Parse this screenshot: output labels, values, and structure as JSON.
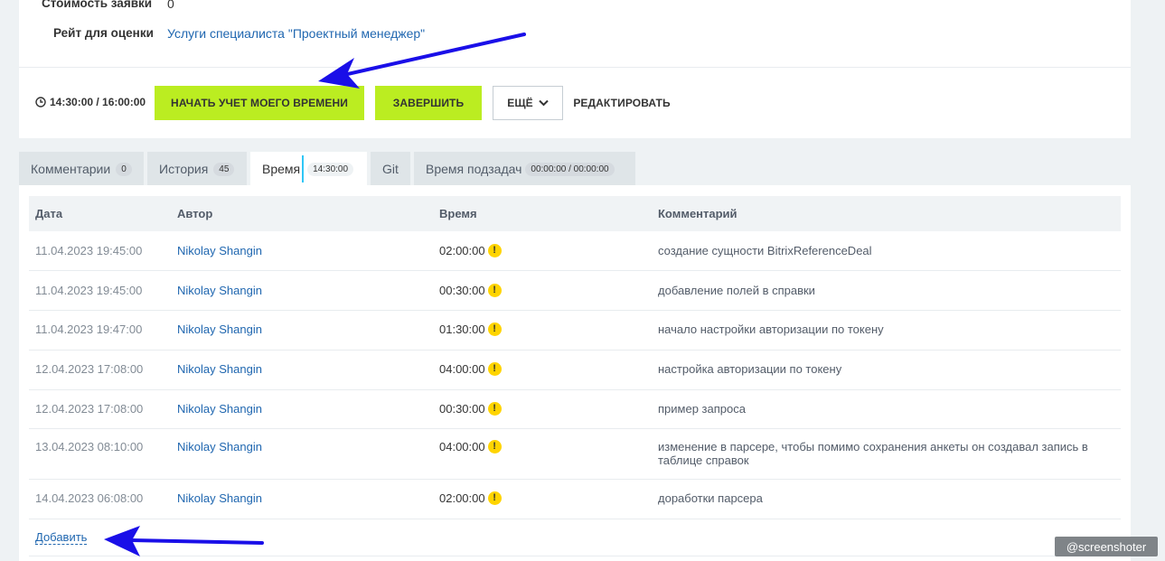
{
  "properties": {
    "cost_label": "Стоимость заявки",
    "cost_value": "0",
    "rate_label": "Рейт для оценки",
    "rate_value": "Услуги специалиста \"Проектный менеджер\""
  },
  "toolbar": {
    "timer_text": "14:30:00 / 16:00:00",
    "start_label": "НАЧАТЬ УЧЕТ МОЕГО ВРЕМЕНИ",
    "finish_label": "ЗАВЕРШИТЬ",
    "more_label": "ЕЩЁ",
    "edit_label": "РЕДАКТИРОВАТЬ"
  },
  "tabs": [
    {
      "label": "Комментарии",
      "badge": "0"
    },
    {
      "label": "История",
      "badge": "45"
    },
    {
      "label": "Время",
      "badge": "14:30:00"
    },
    {
      "label": "Git",
      "badge": ""
    },
    {
      "label": "Время подзадач",
      "badge": "00:00:00 / 00:00:00"
    }
  ],
  "table": {
    "headers": [
      "Дата",
      "Автор",
      "Время",
      "Комментарий"
    ],
    "rows": [
      {
        "date": "11.04.2023 19:45:00",
        "author": "Nikolay Shangin",
        "time": "02:00:00",
        "comment": "создание сущности BitrixReferenceDeal"
      },
      {
        "date": "11.04.2023 19:45:00",
        "author": "Nikolay Shangin",
        "time": "00:30:00",
        "comment": "добавление полей в справки"
      },
      {
        "date": "11.04.2023 19:47:00",
        "author": "Nikolay Shangin",
        "time": "01:30:00",
        "comment": "начало настройки авторизации по токену"
      },
      {
        "date": "12.04.2023 17:08:00",
        "author": "Nikolay Shangin",
        "time": "04:00:00",
        "comment": "настройка авторизации по токену"
      },
      {
        "date": "12.04.2023 17:08:00",
        "author": "Nikolay Shangin",
        "time": "00:30:00",
        "comment": "пример запроса"
      },
      {
        "date": "13.04.2023 08:10:00",
        "author": "Nikolay Shangin",
        "time": "04:00:00",
        "comment": "изменение в парсере, чтобы помимо сохранения анкеты он создавал запись в таблице справок"
      },
      {
        "date": "14.04.2023 06:08:00",
        "author": "Nikolay Shangin",
        "time": "02:00:00",
        "comment": "доработки парсера"
      }
    ],
    "warn_symbol": "!",
    "add_label": "Добавить"
  },
  "watermark": "@screenshoter",
  "colors": {
    "accent_green": "#bbed21",
    "link_blue": "#2067b0",
    "annotation_arrow": "#1a0fe8",
    "warning": "#ffd400"
  }
}
